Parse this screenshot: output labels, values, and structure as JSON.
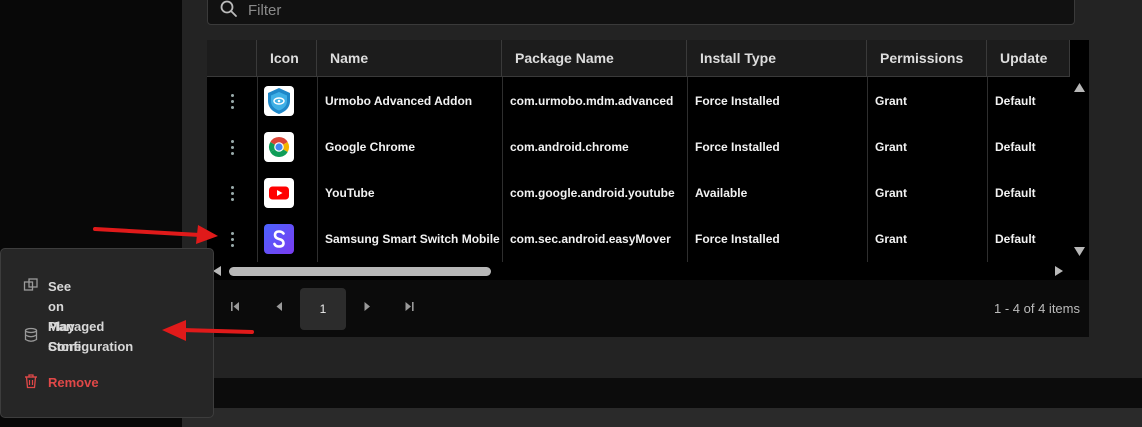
{
  "filter": {
    "placeholder": "Filter",
    "value": ""
  },
  "table": {
    "columns": [
      "Icon",
      "Name",
      "Package Name",
      "Install Type",
      "Permissions",
      "Update"
    ],
    "rows": [
      {
        "icon": "urmobo-addon-icon",
        "name": "Urmobo Advanced Addon",
        "package": "com.urmobo.mdm.advanced",
        "install_type": "Force Installed",
        "permissions": "Grant",
        "update": "Default"
      },
      {
        "icon": "chrome-icon",
        "name": "Google Chrome",
        "package": "com.android.chrome",
        "install_type": "Force Installed",
        "permissions": "Grant",
        "update": "Default"
      },
      {
        "icon": "youtube-icon",
        "name": "YouTube",
        "package": "com.google.android.youtube",
        "install_type": "Available",
        "permissions": "Grant",
        "update": "Default"
      },
      {
        "icon": "samsung-smart-switch-icon",
        "name": "Samsung Smart Switch Mobile",
        "package": "com.sec.android.easyMover",
        "install_type": "Force Installed",
        "permissions": "Grant",
        "update": "Default"
      }
    ]
  },
  "pager": {
    "current_page": "1",
    "summary": "1 - 4 of 4 items"
  },
  "context_menu": {
    "items": [
      {
        "label": "See on Play Store",
        "icon": "external-link-icon"
      },
      {
        "label": "Managed\nConfiguration",
        "icon": "database-icon"
      },
      {
        "label": "Remove",
        "icon": "trash-icon"
      }
    ]
  },
  "colors": {
    "panel": "#232323",
    "grid": "#000000",
    "danger": "#e04848",
    "arrow": "#e01a1a"
  }
}
